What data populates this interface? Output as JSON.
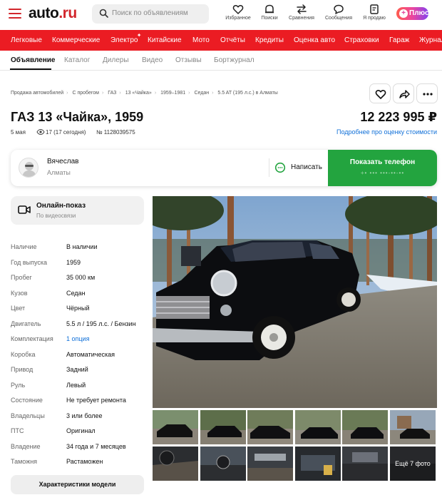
{
  "header": {
    "logo_text": "auto",
    "logo_suffix": ".ru",
    "search_placeholder": "Поиск по объявлениям",
    "icons": [
      {
        "icon": "heart-icon",
        "label": "Избранное"
      },
      {
        "icon": "bell-search-icon",
        "label": "Поиски"
      },
      {
        "icon": "compare-arrows-icon",
        "label": "Сравнения"
      },
      {
        "icon": "message-icon",
        "label": "Сообщения"
      },
      {
        "icon": "sell-icon",
        "label": "Я продаю"
      }
    ],
    "plus_label": "Плюс",
    "brand_color": "#eb1c23"
  },
  "nav": {
    "items": [
      "Легковые",
      "Коммерческие",
      "Электро",
      "Китайские",
      "Мото",
      "Отчёты",
      "Кредиты",
      "Оценка авто",
      "Страховки",
      "Гараж",
      "Журнал"
    ]
  },
  "subtabs": {
    "items": [
      "Объявление",
      "Каталог",
      "Дилеры",
      "Видео",
      "Отзывы",
      "Бортжурнал"
    ],
    "active_index": 0
  },
  "breadcrumbs": [
    "Продажа автомобилей",
    "С пробегом",
    "ГАЗ",
    "13 «Чайка»",
    "1959–1981",
    "Седан",
    "5.5 AT (195 л.с.) в Алматы"
  ],
  "listing": {
    "title": "ГАЗ 13 «Чайка», 1959",
    "price": "12 223 995 ₽",
    "date": "5 мая",
    "views": "17 (17 сегодня)",
    "number": "№ 1128039575",
    "price_link": "Подробнее про оценку стоимости"
  },
  "seller": {
    "name": "Вячеслав",
    "city": "Алматы",
    "write_label": "Написать",
    "phone_button": "Показать телефон",
    "phone_mask": "+• ••• •••-••-••"
  },
  "online_show": {
    "title": "Онлайн-показ",
    "subtitle": "По видеосвязи"
  },
  "specs": [
    {
      "key": "Наличие",
      "value": "В наличии"
    },
    {
      "key": "Год выпуска",
      "value": "1959"
    },
    {
      "key": "Пробег",
      "value": "35 000 км"
    },
    {
      "key": "Кузов",
      "value": "Седан"
    },
    {
      "key": "Цвет",
      "value": "Чёрный"
    },
    {
      "key": "Двигатель",
      "value": "5.5 л / 195 л.с. / Бензин"
    },
    {
      "key": "Комплектация",
      "value": "1 опция",
      "link": true
    },
    {
      "key": "Коробка",
      "value": "Автоматическая"
    },
    {
      "key": "Привод",
      "value": "Задний"
    },
    {
      "key": "Руль",
      "value": "Левый"
    },
    {
      "key": "Состояние",
      "value": "Не требует ремонта"
    },
    {
      "key": "Владельцы",
      "value": "3 или более"
    },
    {
      "key": "ПТС",
      "value": "Оригинал"
    },
    {
      "key": "Владение",
      "value": "34 года и 7 месяцев"
    },
    {
      "key": "Таможня",
      "value": "Растаможен"
    }
  ],
  "specs_button": "Характеристики модели",
  "gallery": {
    "more_photos": "Ещё 7 фото"
  }
}
